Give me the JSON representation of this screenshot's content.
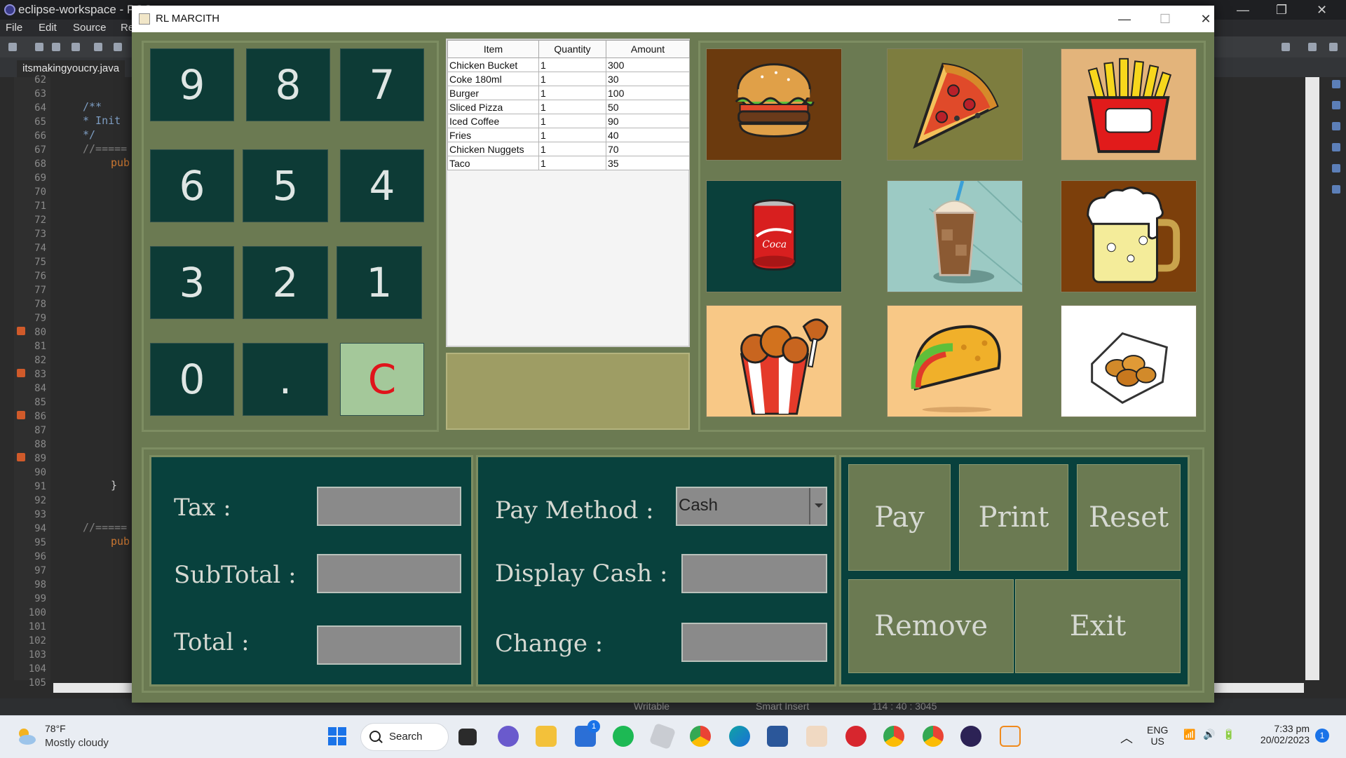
{
  "ide": {
    "title": "eclipse-workspace - POS",
    "menu": [
      "File",
      "Edit",
      "Source",
      "Re"
    ],
    "editor_tab": "itsmakingyoucry.java",
    "line_numbers": [
      "62",
      "63",
      "64",
      "65",
      "66",
      "67",
      "68",
      "69",
      "70",
      "71",
      "72",
      "73",
      "74",
      "75",
      "76",
      "77",
      "78",
      "79",
      "80",
      "81",
      "82",
      "83",
      "84",
      "85",
      "86",
      "87",
      "88",
      "89",
      "90",
      "91",
      "92",
      "93",
      "94",
      "95",
      "96",
      "97",
      "98",
      "99",
      "100",
      "101",
      "102",
      "103",
      "104",
      "105"
    ],
    "code_lines": {
      "l64": "/**",
      "l65": " * Init",
      "l66": " */",
      "l67": "//=====",
      "l68": "pub",
      "l91": "}",
      "l94": "//=====",
      "l95": "pub"
    },
    "status": {
      "writable": "Writable",
      "insert": "Smart Insert",
      "position": "114 : 40 : 3045"
    }
  },
  "window": {
    "title": "RL MARCITH",
    "minimize": "—",
    "maximize": "☐",
    "close": "✕"
  },
  "keypad": {
    "keys": [
      "9",
      "8",
      "7",
      "6",
      "5",
      "4",
      "3",
      "2",
      "1",
      "0",
      ".",
      "C"
    ]
  },
  "order": {
    "columns": [
      "Item",
      "Quantity",
      "Amount"
    ],
    "rows": [
      {
        "item": "Chicken Bucket",
        "quantity": "1",
        "amount": "300"
      },
      {
        "item": "Coke 180ml",
        "quantity": "1",
        "amount": "30"
      },
      {
        "item": "Burger",
        "quantity": "1",
        "amount": "100"
      },
      {
        "item": "Sliced Pizza",
        "quantity": "1",
        "amount": "50"
      },
      {
        "item": "Iced Coffee",
        "quantity": "1",
        "amount": "90"
      },
      {
        "item": "Fries",
        "quantity": "1",
        "amount": "40"
      },
      {
        "item": "Chicken Nuggets",
        "quantity": "1",
        "amount": "70"
      },
      {
        "item": "Taco",
        "quantity": "1",
        "amount": "35"
      }
    ]
  },
  "menu_items": [
    {
      "icon": "burger-icon",
      "bg": "#6b3a0e"
    },
    {
      "icon": "pizza-icon",
      "bg": "#7d7d3f"
    },
    {
      "icon": "fries-icon",
      "bg": "#e3b47b"
    },
    {
      "icon": "cola-can-icon",
      "bg": "#0a403b"
    },
    {
      "icon": "iced-coffee-icon",
      "bg": "#9ccac4"
    },
    {
      "icon": "beer-mug-icon",
      "bg": "#7c3f0b"
    },
    {
      "icon": "chicken-bucket-icon",
      "bg": "#f8c886"
    },
    {
      "icon": "taco-icon",
      "bg": "#f8c886"
    },
    {
      "icon": "chicken-nuggets-icon",
      "bg": "#ffffff"
    }
  ],
  "totals": {
    "tax_label": "Tax :",
    "subtotal_label": "SubTotal :",
    "total_label": "Total :",
    "tax_value": "",
    "subtotal_value": "",
    "total_value": ""
  },
  "payment": {
    "method_label": "Pay Method :",
    "method_value": "Cash",
    "display_cash_label": "Display Cash :",
    "change_label": "Change :",
    "display_cash_value": "",
    "change_value": ""
  },
  "actions": {
    "pay": "Pay",
    "print": "Print",
    "reset": "Reset",
    "remove": "Remove",
    "exit": "Exit"
  },
  "taskbar": {
    "weather_temp": "78°F",
    "weather_desc": "Mostly cloudy",
    "search": "Search",
    "lang_top": "ENG",
    "lang_bottom": "US",
    "time": "7:33 pm",
    "date": "20/02/2023",
    "notification_count": "1",
    "store_badge": "1"
  }
}
